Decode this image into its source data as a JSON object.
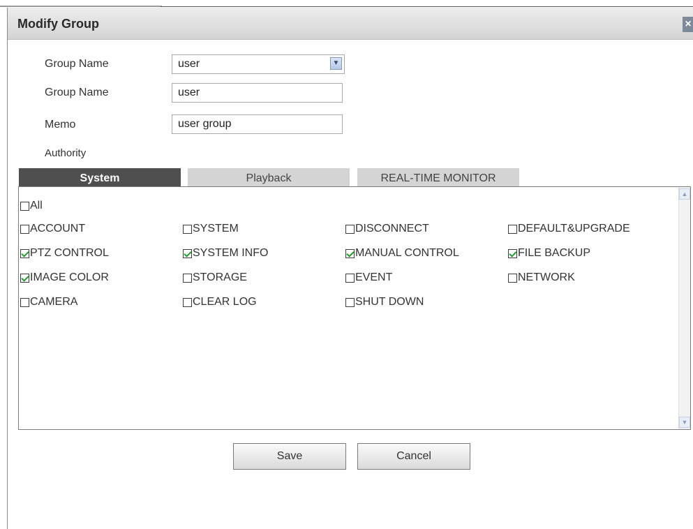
{
  "dialog": {
    "title": "Modify Group",
    "close_label": "×"
  },
  "form": {
    "group_select_label": "Group Name",
    "group_select_value": "user",
    "group_name_label": "Group Name",
    "group_name_value": "user",
    "memo_label": "Memo",
    "memo_value": "user group",
    "authority_label": "Authority"
  },
  "tabs": [
    {
      "label": "System",
      "active": true
    },
    {
      "label": "Playback",
      "active": false
    },
    {
      "label": "REAL-TIME MONITOR",
      "active": false
    }
  ],
  "permissions": {
    "all": {
      "label": "All",
      "checked": false
    },
    "items": [
      {
        "label": "ACCOUNT",
        "checked": false
      },
      {
        "label": "SYSTEM",
        "checked": false
      },
      {
        "label": "DISCONNECT",
        "checked": false
      },
      {
        "label": "DEFAULT&UPGRADE",
        "checked": false
      },
      {
        "label": "PTZ CONTROL",
        "checked": true
      },
      {
        "label": "SYSTEM INFO",
        "checked": true
      },
      {
        "label": "MANUAL CONTROL",
        "checked": true
      },
      {
        "label": "FILE BACKUP",
        "checked": true
      },
      {
        "label": "IMAGE COLOR",
        "checked": true
      },
      {
        "label": "STORAGE",
        "checked": false
      },
      {
        "label": "EVENT",
        "checked": false
      },
      {
        "label": "NETWORK",
        "checked": false
      },
      {
        "label": "CAMERA",
        "checked": false
      },
      {
        "label": "CLEAR LOG",
        "checked": false
      },
      {
        "label": "SHUT DOWN",
        "checked": false
      }
    ]
  },
  "buttons": {
    "save_label": "Save",
    "cancel_label": "Cancel"
  },
  "colors": {
    "active_tab": "#4f4f4f",
    "inactive_tab": "#d4d4d4",
    "checkmark": "#1e9e2a"
  }
}
